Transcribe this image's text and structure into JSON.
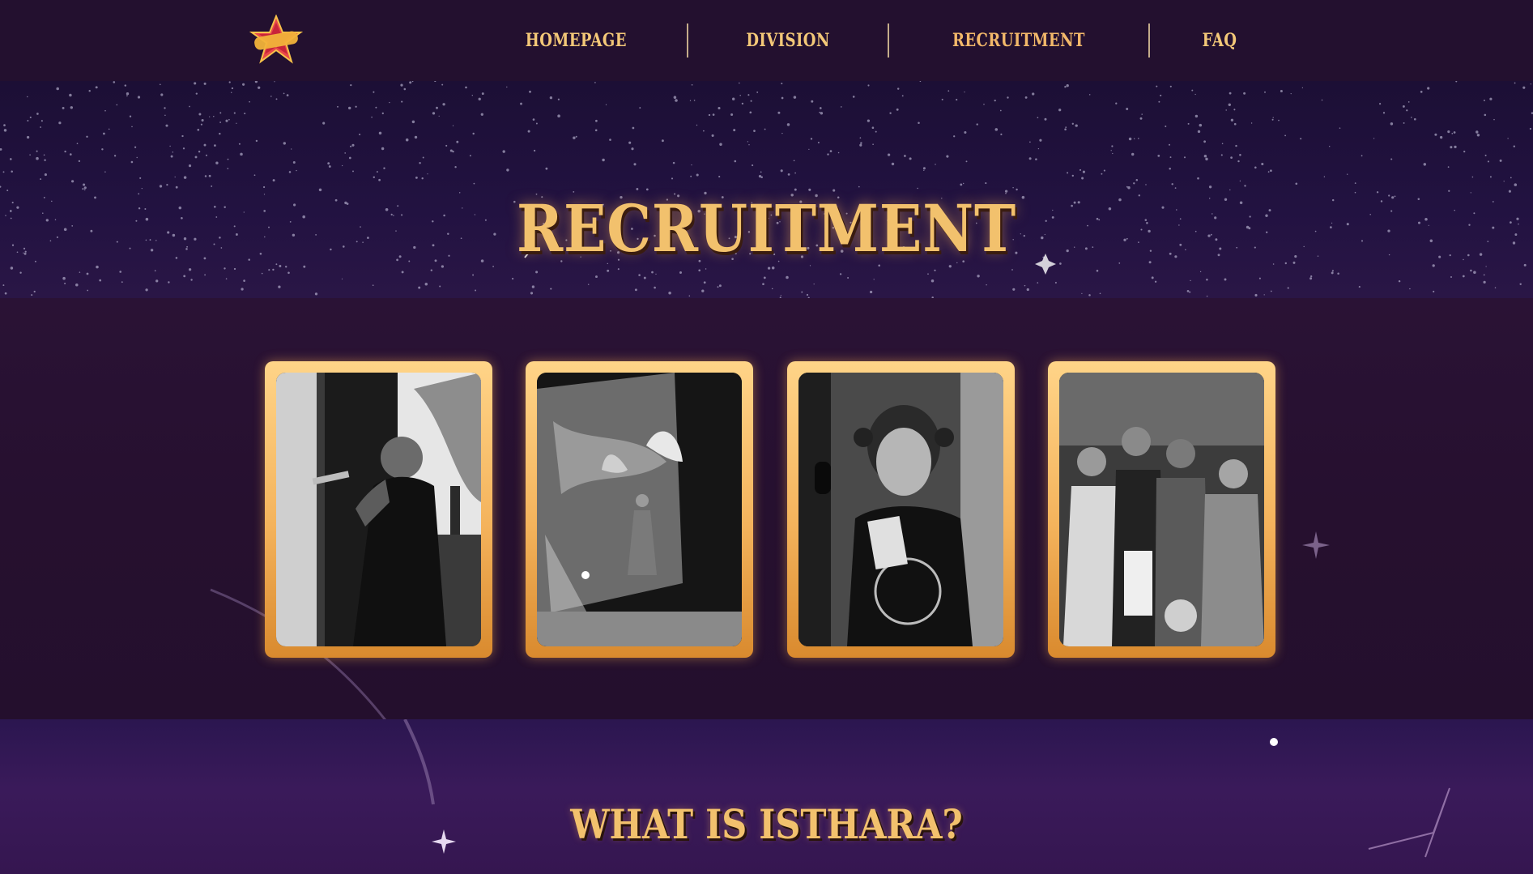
{
  "nav": {
    "logo_text": "Starlight",
    "items": [
      {
        "label": "HOMEPAGE"
      },
      {
        "label": "DIVISION"
      },
      {
        "label": "RECRUITMENT"
      },
      {
        "label": "FAQ"
      }
    ]
  },
  "hero": {
    "title": "RECRUITMENT"
  },
  "gallery": {
    "cards": [
      {
        "alt": "Singer performing with microphone"
      },
      {
        "alt": "Dancer on stage with fans"
      },
      {
        "alt": "Host with headset microphone"
      },
      {
        "alt": "Group holding awards"
      }
    ]
  },
  "section": {
    "title": "WHAT IS ISTHARA?"
  },
  "colors": {
    "accent": "#f2c16d",
    "card_gold": "#f4b35c",
    "background": "#1e0d2c"
  }
}
